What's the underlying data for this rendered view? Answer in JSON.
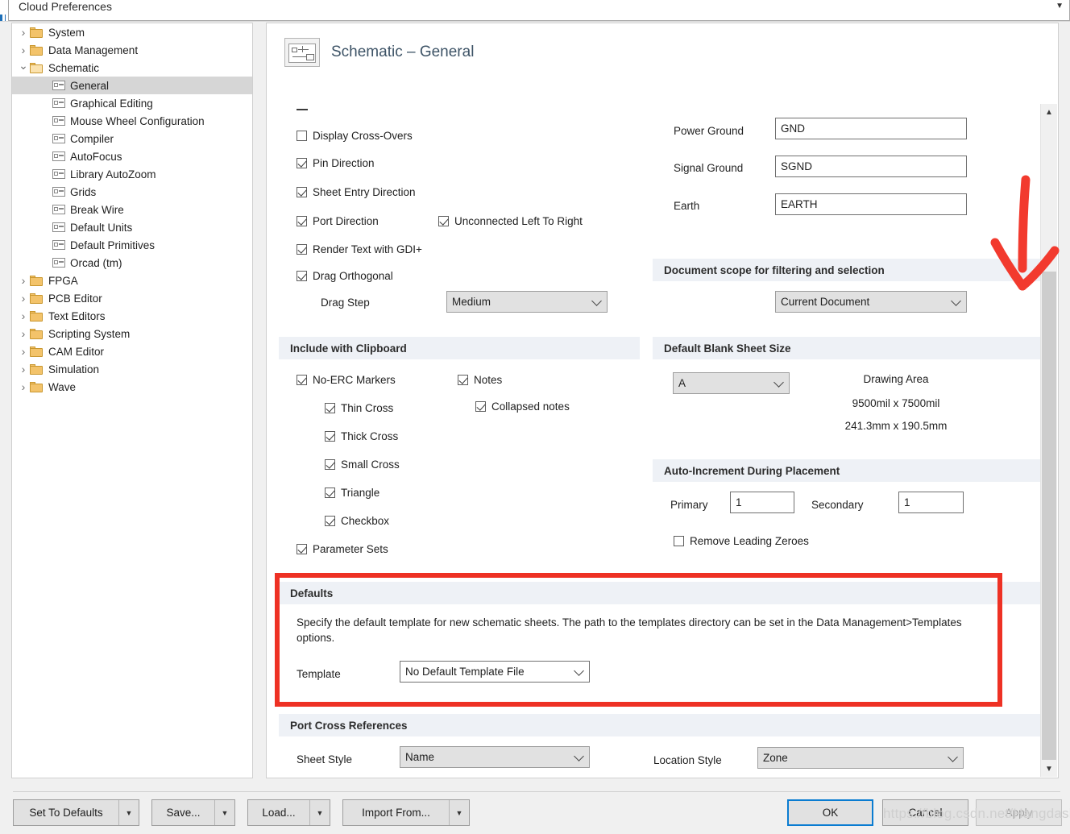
{
  "window": {
    "search_value": "Cloud Preferences",
    "dropdown_icon": "chevron-down-icon"
  },
  "tree": {
    "items": [
      {
        "label": "System",
        "indent": 0,
        "twist": "collapsed",
        "icon": "folder-icon",
        "selected": false
      },
      {
        "label": "Data Management",
        "indent": 0,
        "twist": "collapsed",
        "icon": "folder-icon",
        "selected": false
      },
      {
        "label": "Schematic",
        "indent": 0,
        "twist": "expanded",
        "icon": "folder-open-icon",
        "selected": false
      },
      {
        "label": "General",
        "indent": 1,
        "twist": "none",
        "icon": "page-icon",
        "selected": true
      },
      {
        "label": "Graphical Editing",
        "indent": 1,
        "twist": "none",
        "icon": "page-icon",
        "selected": false
      },
      {
        "label": "Mouse Wheel Configuration",
        "indent": 1,
        "twist": "none",
        "icon": "page-icon",
        "selected": false
      },
      {
        "label": "Compiler",
        "indent": 1,
        "twist": "none",
        "icon": "page-icon",
        "selected": false
      },
      {
        "label": "AutoFocus",
        "indent": 1,
        "twist": "none",
        "icon": "page-icon",
        "selected": false
      },
      {
        "label": "Library AutoZoom",
        "indent": 1,
        "twist": "none",
        "icon": "page-icon",
        "selected": false
      },
      {
        "label": "Grids",
        "indent": 1,
        "twist": "none",
        "icon": "page-icon",
        "selected": false
      },
      {
        "label": "Break Wire",
        "indent": 1,
        "twist": "none",
        "icon": "page-icon",
        "selected": false
      },
      {
        "label": "Default Units",
        "indent": 1,
        "twist": "none",
        "icon": "page-icon",
        "selected": false
      },
      {
        "label": "Default Primitives",
        "indent": 1,
        "twist": "none",
        "icon": "page-icon",
        "selected": false
      },
      {
        "label": "Orcad (tm)",
        "indent": 1,
        "twist": "none",
        "icon": "page-icon",
        "selected": false
      },
      {
        "label": "FPGA",
        "indent": 0,
        "twist": "collapsed",
        "icon": "folder-icon",
        "selected": false
      },
      {
        "label": "PCB Editor",
        "indent": 0,
        "twist": "collapsed",
        "icon": "folder-icon",
        "selected": false
      },
      {
        "label": "Text Editors",
        "indent": 0,
        "twist": "collapsed",
        "icon": "folder-icon",
        "selected": false
      },
      {
        "label": "Scripting System",
        "indent": 0,
        "twist": "collapsed",
        "icon": "folder-icon",
        "selected": false
      },
      {
        "label": "CAM Editor",
        "indent": 0,
        "twist": "collapsed",
        "icon": "folder-icon",
        "selected": false
      },
      {
        "label": "Simulation",
        "indent": 0,
        "twist": "collapsed",
        "icon": "folder-icon",
        "selected": false
      },
      {
        "label": "Wave",
        "indent": 0,
        "twist": "collapsed",
        "icon": "folder-icon",
        "selected": false
      }
    ]
  },
  "page": {
    "title": "Schematic – General",
    "icon": "schematic-document-icon"
  },
  "options": {
    "display_cross_overs": {
      "label": "Display Cross-Overs",
      "checked": false
    },
    "pin_direction": {
      "label": "Pin Direction",
      "checked": true
    },
    "sheet_entry_direction": {
      "label": "Sheet Entry Direction",
      "checked": true
    },
    "port_direction": {
      "label": "Port Direction",
      "checked": true
    },
    "unconnected_left_to_right": {
      "label": "Unconnected Left To Right",
      "checked": true
    },
    "render_text_gdi": {
      "label": "Render Text with GDI+",
      "checked": true
    },
    "drag_orthogonal": {
      "label": "Drag Orthogonal",
      "checked": true
    },
    "drag_step": {
      "label": "Drag Step",
      "value": "Medium"
    }
  },
  "nets": {
    "power_ground": {
      "label": "Power Ground",
      "value": "GND"
    },
    "signal_ground": {
      "label": "Signal Ground",
      "value": "SGND"
    },
    "earth": {
      "label": "Earth",
      "value": "EARTH"
    }
  },
  "document_scope": {
    "header": "Document scope for filtering and selection",
    "value": "Current Document"
  },
  "clipboard": {
    "header": "Include with Clipboard",
    "no_erc_markers": {
      "label": "No-ERC Markers",
      "checked": true
    },
    "thin_cross": {
      "label": "Thin Cross",
      "checked": true
    },
    "thick_cross": {
      "label": "Thick Cross",
      "checked": true
    },
    "small_cross": {
      "label": "Small Cross",
      "checked": true
    },
    "triangle": {
      "label": "Triangle",
      "checked": true
    },
    "checkbox": {
      "label": "Checkbox",
      "checked": true
    },
    "parameter_sets": {
      "label": "Parameter Sets",
      "checked": true
    },
    "notes": {
      "label": "Notes",
      "checked": true
    },
    "collapsed_notes": {
      "label": "Collapsed notes",
      "checked": true
    }
  },
  "sheet_size": {
    "header": "Default Blank Sheet Size",
    "value": "A",
    "drawing_area_label": "Drawing Area",
    "dimensions_mil": "9500mil x 7500mil",
    "dimensions_mm": "241.3mm x 190.5mm"
  },
  "auto_increment": {
    "header": "Auto-Increment During Placement",
    "primary_label": "Primary",
    "primary_value": "1",
    "secondary_label": "Secondary",
    "secondary_value": "1",
    "remove_leading_zeroes": {
      "label": "Remove Leading Zeroes",
      "checked": false
    }
  },
  "defaults": {
    "header": "Defaults",
    "description": "Specify the default template for new schematic sheets.  The path to the templates directory can be set in the Data Management>Templates options.",
    "template_label": "Template",
    "template_value": "No Default Template File",
    "highlight_color": "#ee3124"
  },
  "port_cross_references": {
    "header": "Port Cross References",
    "sheet_style_label": "Sheet Style",
    "sheet_style_value": "Name",
    "location_style_label": "Location Style",
    "location_style_value": "Zone"
  },
  "scrollbar": {
    "up_icon": "chevron-up-icon",
    "down_icon": "chevron-down-icon"
  },
  "annotation": {
    "arrow": "red-down-arrow"
  },
  "footer": {
    "set_to_defaults": "Set To Defaults",
    "save": "Save...",
    "load": "Load...",
    "import_from": "Import From...",
    "ok": "OK",
    "cancel": "Cancel",
    "apply": "Apply"
  },
  "watermark": "https://blog.csdn.net/Hangdashuai"
}
